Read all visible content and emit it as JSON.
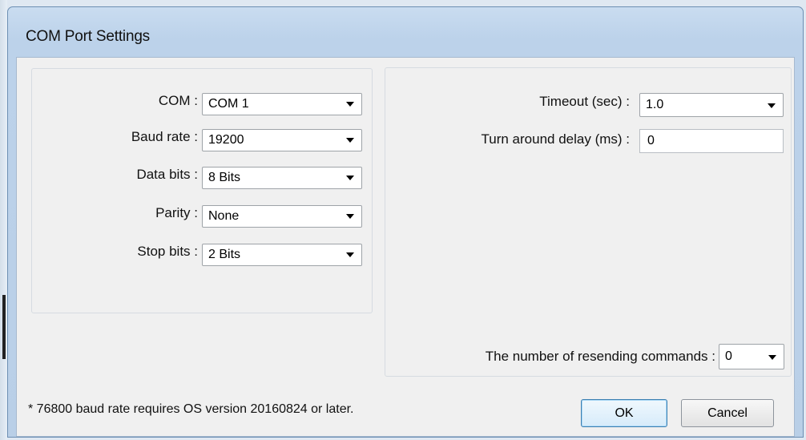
{
  "window": {
    "title": "COM Port Settings"
  },
  "left_group": {
    "com": {
      "label": "COM :",
      "value": "COM 1"
    },
    "baud_rate": {
      "label": "Baud rate :",
      "value": "19200"
    },
    "data_bits": {
      "label": "Data bits :",
      "value": "8 Bits"
    },
    "parity": {
      "label": "Parity :",
      "value": "None"
    },
    "stop_bits": {
      "label": "Stop bits :",
      "value": "2 Bits"
    }
  },
  "right_group": {
    "timeout": {
      "label": "Timeout (sec) :",
      "value": "1.0"
    },
    "turn_around_delay": {
      "label": "Turn around delay (ms) :",
      "value": "0"
    },
    "resending_commands": {
      "label": "The number of resending commands :",
      "value": "0"
    }
  },
  "footer": {
    "note": "* 76800 baud rate requires OS version 20160824 or later.",
    "ok_label": "OK",
    "cancel_label": "Cancel"
  },
  "icons": {
    "dropdown": "chevron-down-icon"
  }
}
